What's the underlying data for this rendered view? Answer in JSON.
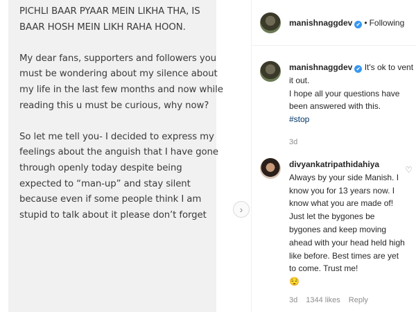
{
  "post": {
    "paragraphs": [
      "PICHLI BAAR PYAAR MEIN LIKHA THA, IS BAAR HOSH MEIN LIKH RAHA HOON.",
      "My dear fans, supporters and followers you must be wondering about my silence about my life in the last few months and now while reading this u must be curious, why now?",
      "So let me tell you- I decided to express my feelings about the anguish that I have gone through openly today despite being expected to “man-up” and stay silent because even if some people think I am stupid to talk about it please don’t forget"
    ]
  },
  "header": {
    "username": "manishnaggdev",
    "verified_mark": "✔",
    "separator": "•",
    "follow_status": "Following"
  },
  "caption": {
    "username": "manishnaggdev",
    "verified_mark": "✔",
    "line1": "It's ok to vent it out.",
    "line2": "I hope all your questions have been answered with this.",
    "hashtag": "#stop",
    "time": "3d"
  },
  "comment": {
    "username": "divyankatripathidahiya",
    "verified_mark": "✔",
    "text": "Always by your side Manish. I know you for 13 years now. I know what you are made of! Just let the bygones be bygones and keep moving ahead with your head held high like before. Best times are yet to come. Trust me!",
    "emoji": "😌",
    "time": "3d",
    "likes": "1344 likes",
    "reply": "Reply"
  },
  "icons": {
    "next_arrow": "chevron-right-icon",
    "heart": "heart-icon"
  }
}
